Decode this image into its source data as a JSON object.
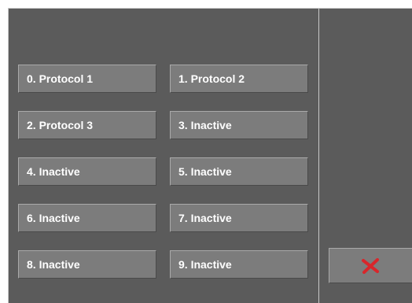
{
  "protocols": [
    {
      "label": "0. Protocol 1"
    },
    {
      "label": "1. Protocol 2"
    },
    {
      "label": "2. Protocol 3"
    },
    {
      "label": "3. Inactive"
    },
    {
      "label": "4. Inactive"
    },
    {
      "label": "5. Inactive"
    },
    {
      "label": "6. Inactive"
    },
    {
      "label": "7. Inactive"
    },
    {
      "label": "8. Inactive"
    },
    {
      "label": "9. Inactive"
    }
  ],
  "cancel": {
    "icon": "close-icon",
    "icon_color": "#d8262b"
  },
  "colors": {
    "panel": "#5b5b5b",
    "button": "#7c7c7c",
    "text": "#ffffff"
  }
}
